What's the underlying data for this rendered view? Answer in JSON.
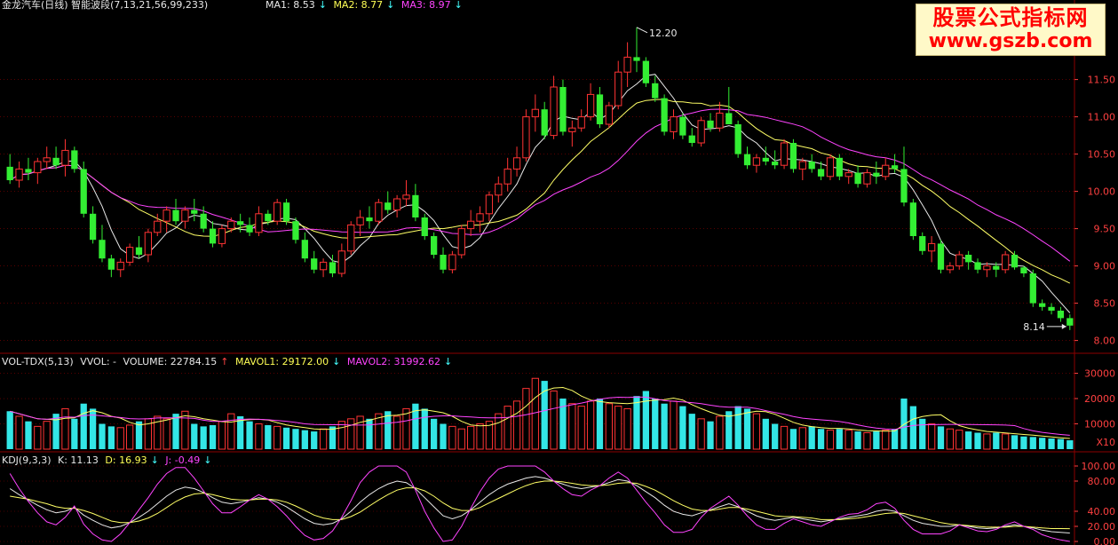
{
  "header": {
    "title": "金龙汽车(日线) 智能波段(7,13,21,56,99,233)",
    "ma1": "MA1: 8.53",
    "ma2": "MA2: 8.77",
    "ma3": "MA3: 8.97"
  },
  "vol_header": {
    "name": "VOL-TDX(5,13)",
    "vvol": "VVOL: -",
    "volume": "VOLUME: 22784.15",
    "mavol1": "MAVOL1: 29172.00",
    "mavol2": "MAVOL2: 31992.62"
  },
  "kdj_header": {
    "name": "KDJ(9,3,3)",
    "k": "K: 11.13",
    "d": "D: 16.93",
    "j": "J: -0.49"
  },
  "watermark": {
    "line1": "股票公式指标网",
    "line2": "www.gszb.com"
  },
  "annotations": {
    "high": "12.20",
    "low": "8.14"
  },
  "vol_unit": "X10",
  "colors": {
    "up": "#ff3333",
    "down": "#33ee33",
    "vol_down": "#33e6e6",
    "ma1": "#e8e8e8",
    "ma2": "#ffff66",
    "ma3": "#ff44ff",
    "grid": "#8b0000",
    "axis_text": "#ff4040"
  },
  "chart_data": [
    {
      "type": "candlestick",
      "title": "金龙汽车(日线) 智能波段(7,13,21,56,99,233)",
      "ylim": [
        7.9,
        12.4
      ],
      "y_ticks": [
        "8.00",
        "8.50",
        "9.00",
        "9.50",
        "10.00",
        "10.50",
        "11.00",
        "11.50"
      ],
      "ohlc": [
        [
          10.33,
          10.5,
          10.1,
          10.15
        ],
        [
          10.15,
          10.4,
          10.05,
          10.3
        ],
        [
          10.3,
          10.45,
          10.15,
          10.25
        ],
        [
          10.25,
          10.45,
          10.1,
          10.4
        ],
        [
          10.4,
          10.6,
          10.3,
          10.45
        ],
        [
          10.45,
          10.6,
          10.3,
          10.35
        ],
        [
          10.35,
          10.7,
          10.2,
          10.55
        ],
        [
          10.55,
          10.6,
          10.25,
          10.3
        ],
        [
          10.3,
          10.4,
          9.65,
          9.7
        ],
        [
          9.7,
          9.8,
          9.3,
          9.35
        ],
        [
          9.35,
          9.55,
          9.05,
          9.1
        ],
        [
          9.1,
          9.15,
          8.85,
          8.95
        ],
        [
          8.95,
          9.1,
          8.85,
          9.05
        ],
        [
          9.05,
          9.3,
          9.0,
          9.25
        ],
        [
          9.25,
          9.4,
          9.1,
          9.15
        ],
        [
          9.15,
          9.5,
          9.05,
          9.45
        ],
        [
          9.45,
          9.7,
          9.4,
          9.6
        ],
        [
          9.6,
          9.8,
          9.45,
          9.75
        ],
        [
          9.75,
          9.9,
          9.55,
          9.6
        ],
        [
          9.6,
          9.8,
          9.5,
          9.75
        ],
        [
          9.75,
          9.9,
          9.6,
          9.7
        ],
        [
          9.7,
          9.8,
          9.45,
          9.5
        ],
        [
          9.5,
          9.6,
          9.25,
          9.3
        ],
        [
          9.3,
          9.55,
          9.25,
          9.5
        ],
        [
          9.5,
          9.65,
          9.45,
          9.6
        ],
        [
          9.6,
          9.7,
          9.45,
          9.55
        ],
        [
          9.55,
          9.65,
          9.4,
          9.45
        ],
        [
          9.45,
          9.8,
          9.4,
          9.7
        ],
        [
          9.7,
          9.75,
          9.55,
          9.6
        ],
        [
          9.6,
          9.9,
          9.55,
          9.85
        ],
        [
          9.85,
          9.9,
          9.55,
          9.6
        ],
        [
          9.6,
          9.65,
          9.3,
          9.35
        ],
        [
          9.35,
          9.45,
          9.05,
          9.1
        ],
        [
          9.1,
          9.2,
          8.9,
          8.95
        ],
        [
          8.95,
          9.1,
          8.85,
          9.05
        ],
        [
          9.05,
          9.15,
          8.85,
          8.9
        ],
        [
          8.9,
          9.3,
          8.85,
          9.2
        ],
        [
          9.2,
          9.6,
          9.15,
          9.55
        ],
        [
          9.55,
          9.75,
          9.4,
          9.65
        ],
        [
          9.65,
          9.8,
          9.5,
          9.6
        ],
        [
          9.6,
          9.9,
          9.55,
          9.85
        ],
        [
          9.85,
          10.0,
          9.7,
          9.75
        ],
        [
          9.75,
          9.95,
          9.65,
          9.9
        ],
        [
          9.9,
          10.15,
          9.8,
          9.95
        ],
        [
          9.95,
          10.1,
          9.6,
          9.65
        ],
        [
          9.65,
          9.7,
          9.35,
          9.4
        ],
        [
          9.4,
          9.45,
          9.1,
          9.15
        ],
        [
          9.15,
          9.25,
          8.9,
          8.95
        ],
        [
          8.95,
          9.2,
          8.9,
          9.15
        ],
        [
          9.15,
          9.55,
          9.1,
          9.5
        ],
        [
          9.5,
          9.75,
          9.4,
          9.6
        ],
        [
          9.6,
          9.8,
          9.45,
          9.7
        ],
        [
          9.7,
          10.0,
          9.6,
          9.95
        ],
        [
          9.95,
          10.2,
          9.85,
          10.1
        ],
        [
          10.1,
          10.45,
          10.0,
          10.3
        ],
        [
          10.3,
          10.6,
          10.2,
          10.45
        ],
        [
          10.45,
          11.1,
          10.4,
          11.0
        ],
        [
          11.0,
          11.3,
          10.8,
          11.1
        ],
        [
          11.1,
          11.2,
          10.7,
          10.75
        ],
        [
          10.75,
          11.55,
          10.7,
          11.4
        ],
        [
          11.4,
          11.5,
          10.75,
          10.8
        ],
        [
          10.8,
          10.95,
          10.6,
          10.85
        ],
        [
          10.85,
          11.1,
          10.8,
          11.0
        ],
        [
          11.0,
          11.45,
          10.95,
          11.3
        ],
        [
          11.3,
          11.4,
          10.85,
          10.9
        ],
        [
          10.9,
          11.2,
          10.85,
          11.15
        ],
        [
          11.15,
          11.75,
          11.1,
          11.6
        ],
        [
          11.6,
          12.0,
          11.4,
          11.8
        ],
        [
          11.8,
          12.2,
          11.6,
          11.75
        ],
        [
          11.75,
          11.8,
          11.4,
          11.45
        ],
        [
          11.45,
          11.55,
          11.2,
          11.25
        ],
        [
          11.25,
          11.3,
          10.75,
          10.8
        ],
        [
          10.8,
          11.1,
          10.7,
          11.0
        ],
        [
          11.0,
          11.05,
          10.7,
          10.75
        ],
        [
          10.75,
          10.85,
          10.6,
          10.65
        ],
        [
          10.65,
          11.0,
          10.6,
          10.95
        ],
        [
          10.95,
          11.05,
          10.8,
          10.85
        ],
        [
          10.85,
          11.2,
          10.8,
          11.05
        ],
        [
          11.05,
          11.4,
          10.95,
          10.9
        ],
        [
          10.9,
          10.95,
          10.45,
          10.5
        ],
        [
          10.5,
          10.6,
          10.3,
          10.35
        ],
        [
          10.35,
          10.5,
          10.25,
          10.45
        ],
        [
          10.45,
          10.6,
          10.35,
          10.4
        ],
        [
          10.4,
          10.55,
          10.3,
          10.35
        ],
        [
          10.35,
          10.7,
          10.3,
          10.65
        ],
        [
          10.65,
          10.7,
          10.25,
          10.3
        ],
        [
          10.3,
          10.45,
          10.15,
          10.4
        ],
        [
          10.4,
          10.5,
          10.25,
          10.3
        ],
        [
          10.3,
          10.4,
          10.15,
          10.2
        ],
        [
          10.2,
          10.5,
          10.15,
          10.45
        ],
        [
          10.45,
          10.5,
          10.15,
          10.2
        ],
        [
          10.2,
          10.3,
          10.1,
          10.25
        ],
        [
          10.25,
          10.35,
          10.05,
          10.1
        ],
        [
          10.1,
          10.3,
          10.05,
          10.25
        ],
        [
          10.25,
          10.4,
          10.1,
          10.2
        ],
        [
          10.2,
          10.45,
          10.15,
          10.35
        ],
        [
          10.35,
          10.5,
          10.25,
          10.3
        ],
        [
          10.3,
          10.6,
          9.8,
          9.85
        ],
        [
          9.85,
          9.9,
          9.35,
          9.4
        ],
        [
          9.4,
          9.45,
          9.15,
          9.2
        ],
        [
          9.2,
          9.4,
          9.05,
          9.3
        ],
        [
          9.3,
          9.35,
          8.9,
          8.95
        ],
        [
          8.95,
          9.05,
          8.9,
          9.0
        ],
        [
          9.0,
          9.2,
          8.95,
          9.15
        ],
        [
          9.15,
          9.2,
          8.95,
          9.05
        ],
        [
          9.05,
          9.1,
          8.9,
          8.95
        ],
        [
          8.95,
          9.05,
          8.85,
          9.0
        ],
        [
          9.0,
          9.05,
          8.85,
          8.95
        ],
        [
          8.95,
          9.2,
          8.9,
          9.15
        ],
        [
          9.15,
          9.2,
          8.95,
          8.98
        ],
        [
          8.98,
          9.0,
          8.85,
          8.9
        ],
        [
          8.9,
          8.95,
          8.45,
          8.5
        ],
        [
          8.5,
          8.55,
          8.4,
          8.45
        ],
        [
          8.45,
          8.5,
          8.35,
          8.4
        ],
        [
          8.4,
          8.45,
          8.25,
          8.3
        ],
        [
          8.3,
          8.35,
          8.14,
          8.2
        ]
      ],
      "ma_periods": [
        5,
        13,
        21
      ]
    },
    {
      "type": "bar",
      "title": "VOL-TDX(5,13)",
      "ylim": [
        0,
        33000
      ],
      "y_ticks": [
        "10000",
        "20000",
        "30000"
      ],
      "values": [
        15000,
        13000,
        11000,
        9000,
        11000,
        14000,
        16000,
        12000,
        18000,
        16000,
        10000,
        9000,
        8500,
        9500,
        11000,
        12000,
        13000,
        12000,
        14000,
        15000,
        10000,
        9000,
        9500,
        11000,
        14000,
        13000,
        11000,
        10000,
        9500,
        9000,
        8500,
        8000,
        7500,
        7000,
        8000,
        9000,
        11000,
        12000,
        13000,
        12000,
        14000,
        15000,
        13000,
        16000,
        18000,
        16000,
        12000,
        10000,
        9000,
        8000,
        9000,
        10000,
        11000,
        14000,
        17000,
        19000,
        24000,
        28000,
        27000,
        23000,
        20000,
        18000,
        17000,
        19000,
        20000,
        18000,
        17000,
        16000,
        21000,
        23000,
        20000,
        18000,
        19000,
        17000,
        14000,
        12000,
        11000,
        13000,
        15000,
        17000,
        16000,
        14000,
        12000,
        10000,
        9000,
        8000,
        8500,
        9000,
        8000,
        7500,
        8000,
        7500,
        7000,
        6500,
        7000,
        7500,
        8000,
        20000,
        17000,
        12000,
        10000,
        9000,
        8000,
        7500,
        7000,
        6500,
        6000,
        6500,
        6000,
        5500,
        5000,
        4800,
        4500,
        4200,
        4000,
        3500
      ],
      "mavol_periods": [
        5,
        13
      ]
    },
    {
      "type": "line",
      "title": "KDJ(9,3,3)",
      "ylim": [
        0,
        100
      ],
      "y_ticks": [
        "0.00",
        "20.00",
        "40.00",
        "80.00",
        "100.00"
      ],
      "series": [
        {
          "name": "K",
          "values": [
            70,
            62,
            55,
            48,
            42,
            38,
            40,
            45,
            35,
            28,
            22,
            18,
            20,
            25,
            32,
            40,
            50,
            60,
            68,
            72,
            70,
            65,
            58,
            52,
            50,
            52,
            55,
            58,
            56,
            52,
            46,
            38,
            30,
            24,
            22,
            24,
            30,
            40,
            52,
            62,
            70,
            76,
            80,
            78,
            70,
            58,
            46,
            34,
            30,
            34,
            42,
            52,
            62,
            70,
            76,
            80,
            84,
            86,
            84,
            80,
            76,
            72,
            70,
            72,
            74,
            78,
            82,
            80,
            74,
            66,
            58,
            48,
            40,
            36,
            34,
            38,
            42,
            46,
            50,
            46,
            40,
            34,
            30,
            28,
            30,
            32,
            30,
            28,
            26,
            28,
            30,
            32,
            34,
            36,
            40,
            42,
            40,
            34,
            28,
            24,
            22,
            20,
            20,
            22,
            20,
            18,
            17,
            18,
            20,
            22,
            20,
            18,
            15,
            13,
            12,
            11.13
          ]
        },
        {
          "name": "D",
          "values": [
            60,
            58,
            56,
            53,
            50,
            46,
            44,
            44,
            41,
            37,
            32,
            27,
            25,
            25,
            27,
            31,
            37,
            45,
            53,
            59,
            63,
            64,
            62,
            59,
            56,
            55,
            55,
            56,
            56,
            55,
            52,
            47,
            41,
            35,
            31,
            29,
            29,
            33,
            39,
            47,
            55,
            62,
            68,
            71,
            71,
            67,
            60,
            51,
            44,
            41,
            41,
            45,
            51,
            57,
            63,
            69,
            74,
            78,
            80,
            80,
            79,
            77,
            75,
            74,
            74,
            75,
            77,
            78,
            77,
            73,
            68,
            61,
            54,
            48,
            43,
            41,
            41,
            43,
            45,
            45,
            43,
            40,
            37,
            34,
            33,
            33,
            32,
            31,
            29,
            29,
            29,
            30,
            31,
            33,
            35,
            37,
            38,
            37,
            34,
            31,
            28,
            25,
            23,
            22,
            21,
            20,
            19,
            19,
            19,
            20,
            20,
            19,
            18,
            17,
            17,
            16.93
          ]
        },
        {
          "name": "J",
          "values": [
            90,
            70,
            53,
            38,
            26,
            22,
            32,
            47,
            23,
            10,
            2,
            0,
            10,
            25,
            42,
            58,
            76,
            90,
            98,
            98,
            84,
            67,
            50,
            38,
            38,
            46,
            55,
            62,
            56,
            46,
            34,
            20,
            8,
            2,
            4,
            14,
            32,
            54,
            78,
            92,
            100,
            100,
            100,
            92,
            68,
            40,
            18,
            0,
            2,
            20,
            44,
            66,
            84,
            96,
            100,
            100,
            100,
            100,
            92,
            80,
            70,
            62,
            60,
            68,
            74,
            84,
            92,
            84,
            68,
            52,
            38,
            22,
            12,
            12,
            16,
            32,
            44,
            52,
            60,
            48,
            34,
            22,
            16,
            16,
            24,
            30,
            26,
            22,
            20,
            26,
            32,
            36,
            37,
            42,
            50,
            52,
            44,
            28,
            16,
            10,
            10,
            10,
            14,
            22,
            18,
            14,
            13,
            16,
            22,
            26,
            20,
            16,
            9,
            5,
            2,
            0
          ]
        }
      ]
    }
  ]
}
